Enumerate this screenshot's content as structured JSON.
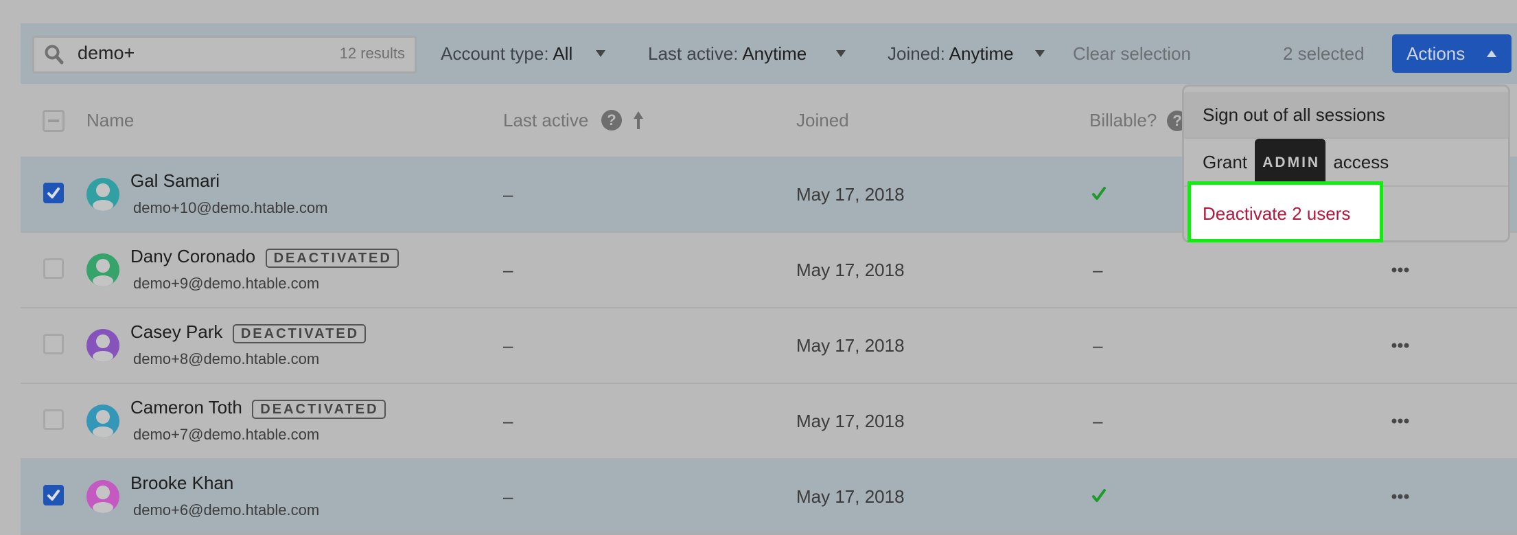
{
  "toolbar": {
    "search": {
      "value": "demo+",
      "result_count": "12 results",
      "icon": "search-icon"
    },
    "filters": [
      {
        "label": "Account type:",
        "value": "All"
      },
      {
        "label": "Last active:",
        "value": "Anytime"
      },
      {
        "label": "Joined:",
        "value": "Anytime"
      }
    ],
    "clear_selection_label": "Clear selection",
    "selected_count": "2 selected",
    "actions_label": "Actions"
  },
  "table": {
    "columns": [
      {
        "label": "Name"
      },
      {
        "label": "Last active",
        "help": "?",
        "sort": "ascending"
      },
      {
        "label": "Joined"
      },
      {
        "label": "Billable?",
        "help": "?"
      }
    ],
    "rows": [
      {
        "name": "Gal Samari",
        "email": "demo+10@demo.htable.com",
        "badge": null,
        "selected": true,
        "last_active": "–",
        "joined": "May 17, 2018",
        "billable": true,
        "avatar_color": "#31a0a2"
      },
      {
        "name": "Dany Coronado",
        "email": "demo+9@demo.htable.com",
        "badge": "DEACTIVATED",
        "selected": false,
        "last_active": "–",
        "joined": "May 17, 2018",
        "billable": false,
        "billable_text": "–",
        "avatar_color": "#35a36a"
      },
      {
        "name": "Casey Park",
        "email": "demo+8@demo.htable.com",
        "badge": "DEACTIVATED",
        "selected": false,
        "last_active": "–",
        "joined": "May 17, 2018",
        "billable": false,
        "billable_text": "–",
        "avatar_color": "#8553bb"
      },
      {
        "name": "Cameron Toth",
        "email": "demo+7@demo.htable.com",
        "badge": "DEACTIVATED",
        "selected": false,
        "last_active": "–",
        "joined": "May 17, 2018",
        "billable": false,
        "billable_text": "–",
        "avatar_color": "#3597b8"
      },
      {
        "name": "Brooke Khan",
        "email": "demo+6@demo.htable.com",
        "badge": null,
        "selected": true,
        "last_active": "–",
        "joined": "May 17, 2018",
        "billable": true,
        "avatar_color": "#c359c1"
      }
    ]
  },
  "actions_menu": {
    "items": [
      {
        "label": "Sign out of all sessions"
      },
      {
        "label_before": "Grant",
        "badge": "ADMIN",
        "label_after": "access"
      },
      {
        "label": "Deactivate 2 users",
        "danger": true,
        "highlighted": true
      }
    ]
  },
  "colors": {
    "accent": "#1f55b7",
    "selected_row": "#a6b0b7",
    "danger": "#b4173f",
    "billable_check": "#1e9a2a",
    "highlight_outline": "#10ee10"
  }
}
